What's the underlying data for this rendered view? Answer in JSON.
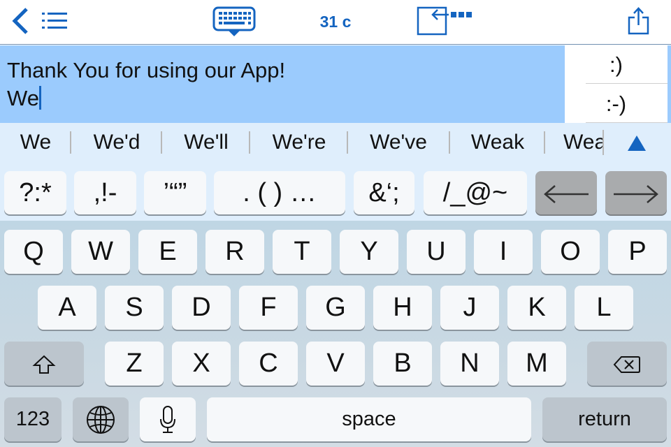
{
  "header": {
    "back_icon": "chevron-left-icon",
    "menu_icon": "list-icon",
    "keyboard_icon": "keyboard-hide-icon",
    "char_count": "31 c",
    "exit_icon": "exit-arrow-icon",
    "share_icon": "share-icon",
    "accent_color": "#1464c0"
  },
  "editor": {
    "line1": "Thank You for using our App!",
    "line2": "We",
    "background_color": "#9bcbfd"
  },
  "emoticons": [
    ":)",
    ":-)"
  ],
  "suggestions": [
    "We",
    "We'd",
    "We'll",
    "We're",
    "We've",
    "Weak",
    "Wea"
  ],
  "suggestions_expand_icon": "triangle-up-icon",
  "symbol_keys": [
    "?:*",
    ",!-",
    "’“”",
    ". ( ) …",
    "&‘;",
    "/_@~"
  ],
  "cursor_keys": {
    "left": "←",
    "right": "→"
  },
  "keyboard": {
    "row1": [
      "Q",
      "W",
      "E",
      "R",
      "T",
      "Y",
      "U",
      "I",
      "O",
      "P"
    ],
    "row2": [
      "A",
      "S",
      "D",
      "F",
      "G",
      "H",
      "J",
      "K",
      "L"
    ],
    "row3": [
      "Z",
      "X",
      "C",
      "V",
      "B",
      "N",
      "M"
    ],
    "numbers_label": "123",
    "space_label": "space",
    "return_label": "return"
  }
}
